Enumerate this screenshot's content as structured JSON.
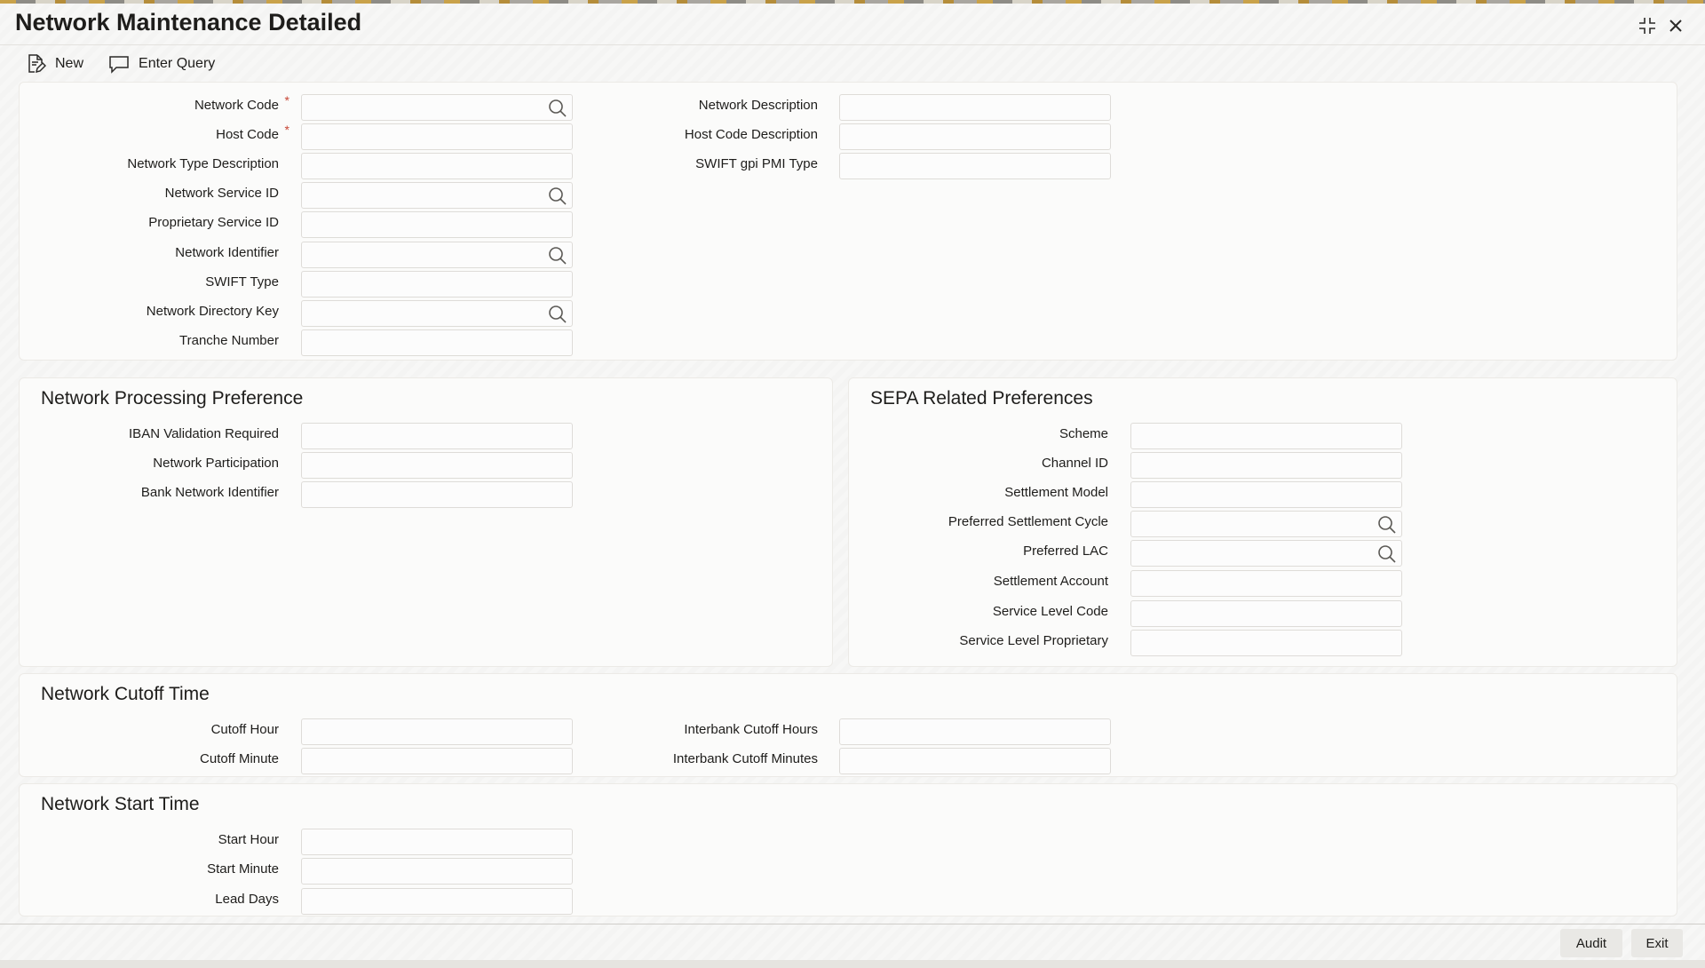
{
  "window": {
    "title": "Network Maintenance Detailed",
    "controls": {
      "minimize_icon": "collapse-icon",
      "close_icon": "close-icon"
    }
  },
  "toolbar": {
    "new_label": "New",
    "enter_query_label": "Enter Query"
  },
  "main": {
    "network_code": "Network Code",
    "host_code": "Host Code",
    "network_type_description": "Network Type Description",
    "network_service_id": "Network Service ID",
    "proprietary_service_id": "Proprietary Service ID",
    "network_identifier": "Network Identifier",
    "swift_type": "SWIFT Type",
    "network_directory_key": "Network Directory Key",
    "tranche_number": "Tranche Number",
    "network_description": "Network Description",
    "host_code_description": "Host Code Description",
    "swift_gpi_pmi_type": "SWIFT gpi PMI Type",
    "required_marker": "*"
  },
  "processing": {
    "title": "Network Processing Preference",
    "iban_validation_required": "IBAN Validation Required",
    "network_participation": "Network Participation",
    "bank_network_identifier": "Bank Network Identifier"
  },
  "sepa": {
    "title": "SEPA Related Preferences",
    "scheme": "Scheme",
    "channel_id": "Channel ID",
    "settlement_model": "Settlement Model",
    "preferred_settlement_cycle": "Preferred Settlement Cycle",
    "preferred_lac": "Preferred LAC",
    "settlement_account": "Settlement Account",
    "service_level_code": "Service Level Code",
    "service_level_proprietary": "Service Level Proprietary"
  },
  "cutoff": {
    "title": "Network Cutoff Time",
    "cutoff_hour": "Cutoff Hour",
    "cutoff_minute": "Cutoff Minute",
    "interbank_cutoff_hours": "Interbank Cutoff Hours",
    "interbank_cutoff_minutes": "Interbank Cutoff Minutes"
  },
  "start": {
    "title": "Network Start Time",
    "start_hour": "Start Hour",
    "start_minute": "Start Minute",
    "lead_days": "Lead Days"
  },
  "footer": {
    "audit_label": "Audit",
    "exit_label": "Exit"
  },
  "colors": {
    "required": "#c74634",
    "panel_bg": "#fbfbfa",
    "field_border": "#dedcd8"
  }
}
